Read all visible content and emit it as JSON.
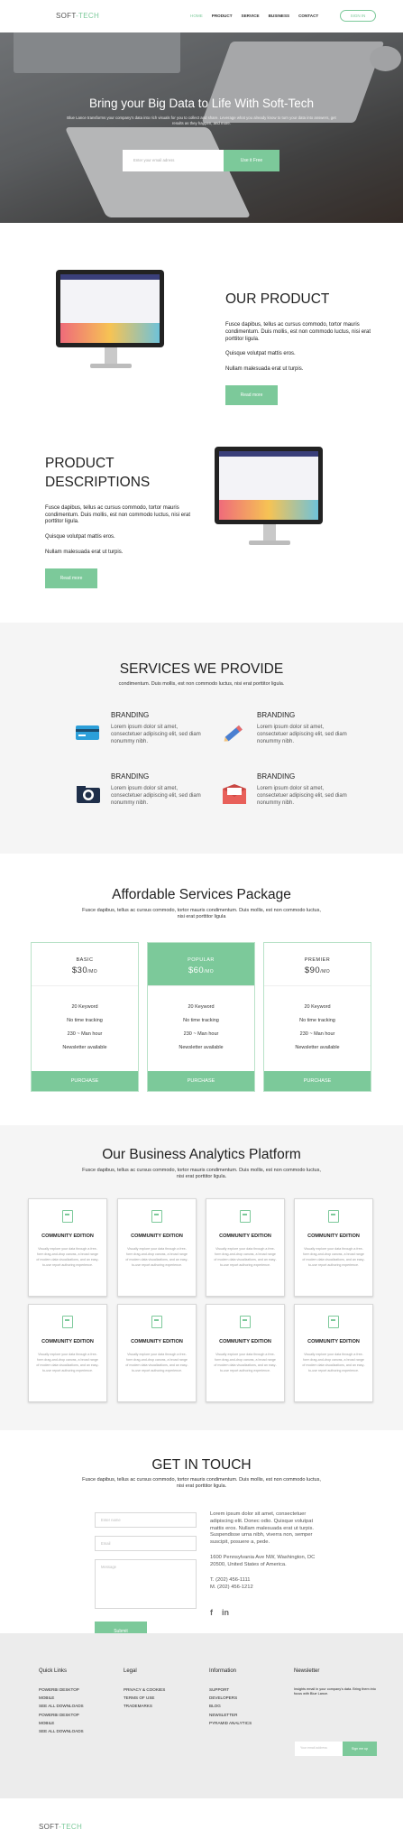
{
  "nav": {
    "logo_left": "SOFT",
    "logo_right": "-TECH",
    "links": [
      "HOME",
      "PRODUCT",
      "SERVICE",
      "BUSINESS",
      "CONTACT"
    ],
    "signin": "SIGN IN"
  },
  "hero": {
    "title": "Bring your Big Data to Life With Soft-Tech",
    "text": "Blue Lance transforms your company's data into rich visuals for you to collect and share. Leverage what you already know to turn your data into answers, get results as they happen, and more.",
    "email_placeholder": "Enter your email adress",
    "cta": "Use it Free"
  },
  "product": {
    "title": "OUR PRODUCT",
    "p1": "Fusce dapibus, tellus ac cursus commodo, tortor mauris condimentum. Duis mollis, est non commodo luctus, nisi erat porttitor ligula.",
    "p2": "Quisque volutpat mattis eros.",
    "p3": "Nullam malesuada erat ut turpis.",
    "btn": "Read more"
  },
  "desc": {
    "title": "PRODUCT DESCRIPTIONS",
    "p1": "Fusce dapibus, tellus ac cursus commodo, tortor mauris condimentum. Duis mollis, est non commodo luctus, nisi erat porttitor ligula.",
    "p2": "Quisque volutpat mattis eros.",
    "p3": "Nullam malesuada erat ut turpis.",
    "btn": "Read more"
  },
  "services": {
    "title": "SERVICES WE PROVIDE",
    "sub": "condimentum. Duis mollis, est non commodo luctus, nisi erat porttitor ligula.",
    "items": [
      {
        "title": "BRANDING",
        "text": "Lorem ipsum dolor sit amet, consectetuer adipiscing elit, sed diam nonummy nibh.",
        "icon": "card-icon"
      },
      {
        "title": "BRANDING",
        "text": "Lorem ipsum dolor sit amet, consectetuer adipiscing elit, sed diam nonummy nibh.",
        "icon": "pencil-icon"
      },
      {
        "title": "BRANDING",
        "text": "Lorem ipsum dolor sit amet, consectetuer adipiscing elit, sed diam nonummy nibh.",
        "icon": "camera-icon"
      },
      {
        "title": "BRANDING",
        "text": "Lorem ipsum dolor sit amet, consectetuer adipiscing elit, sed diam nonummy nibh.",
        "icon": "mail-icon"
      }
    ]
  },
  "pricing": {
    "title": "Affordable Services Package",
    "sub": "Fusce dapibus, tellus ac cursus commodo, tortor mauris condimentum. Duis mollis, est non commodo luctus, nisi erat porttitor ligula",
    "plans": [
      {
        "name": "BASIC",
        "price": "$30",
        "per": "/MO",
        "features": [
          "20 Keyword",
          "No time tracking",
          "230 ~ Man hour",
          "Newsletter available"
        ],
        "cta": "PURCHASE"
      },
      {
        "name": "POPULAR",
        "price": "$60",
        "per": "/MO",
        "features": [
          "20 Keyword",
          "No time tracking",
          "230 ~ Man hour",
          "Newsletter available"
        ],
        "cta": "PURCHASE"
      },
      {
        "name": "PREMIER",
        "price": "$90",
        "per": "/MO",
        "features": [
          "20 Keyword",
          "No time tracking",
          "230 ~ Man hour",
          "Newsletter available"
        ],
        "cta": "PURCHASE"
      }
    ]
  },
  "analytics": {
    "title": "Our Business Analytics Platform",
    "sub": "Fusce dapibus, tellus ac cursus commodo, tortor mauris condimentum. Duis mollis, est non commodo luctus, nisi erat porttitor ligula.",
    "card_title": "COMMUNITY EDITION",
    "card_text": "Visually explore your data through a free-form drag-and-drop canvas, a broad range of modern data visualizations, and an easy-to-use report authoring experience."
  },
  "contact": {
    "title": "GET IN TOUCH",
    "sub": "Fusce dapibus, tellus ac cursus commodo, tortor mauris condimentum. Duis mollis, est non commodo luctus, nisi erat porttitor ligula.",
    "name_ph": "Enter name",
    "email_ph": "Email",
    "msg_ph": "Message",
    "submit": "Submit",
    "info": "Lorem ipsum dolor sit amet, consectetuer adipiscing elit. Donec odio. Quisque volutpat mattis eros. Nullam malesuada erat ut turpis. Suspendisse urna nibh, viverra non, semper suscipit, posuere a, pede.",
    "address": "1600 Pennsylvania Ave NW, Washington, DC 20500, United States of America.",
    "tel": "T. (202) 456-1111",
    "mobile": "M. (202) 456-1212",
    "social": [
      "facebook-icon",
      "linkedin-icon"
    ]
  },
  "footer": {
    "cols": [
      {
        "title": "Quick Links",
        "items": [
          "POWERBI DESKTOP",
          "MOBILE",
          "SEE ALL DOWNLOADS",
          "POWERBI DESKTOP",
          "MOBILE",
          "SEE ALL DOWNLOADS"
        ]
      },
      {
        "title": "Legal",
        "items": [
          "PRIVACY & COOKIES",
          "TERMS OF USE",
          "TRADEMARKS"
        ]
      },
      {
        "title": "Information",
        "items": [
          "SUPPORT",
          "DEVELOPERS",
          "BLOG",
          "NEWSLETTER",
          "PYRAMID ANALYTICS"
        ]
      }
    ],
    "newsletter_title": "Newsletter",
    "newsletter_text": "Insights email in your company's data. Bring them into focus with Blue Lance.",
    "newsletter_ph": "Your email address",
    "newsletter_btn": "Sign me up",
    "logo_left": "SOFT",
    "logo_right": "-TECH"
  }
}
